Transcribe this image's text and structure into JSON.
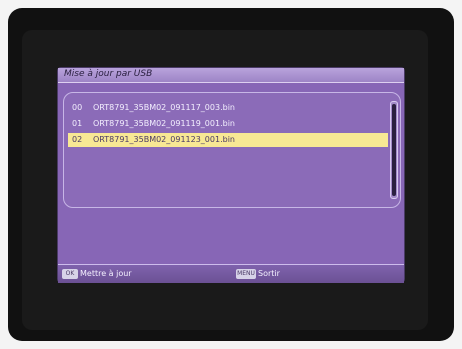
{
  "dialog": {
    "title": "Mise à jour par USB"
  },
  "files": [
    {
      "index": "00",
      "name": "ORT8791_35BM02_091117_003.bin",
      "selected": false
    },
    {
      "index": "01",
      "name": "ORT8791_35BM02_091119_001.bin",
      "selected": false
    },
    {
      "index": "02",
      "name": "ORT8791_35BM02_091123_001.bin",
      "selected": true
    }
  ],
  "footer": {
    "ok_key": "OK",
    "ok_label": "Mettre à jour",
    "menu_key": "MENU",
    "menu_label": "Sortir"
  },
  "colors": {
    "panel": "#8766b6",
    "highlight": "#f8e894",
    "text": "#f4f0ff"
  }
}
